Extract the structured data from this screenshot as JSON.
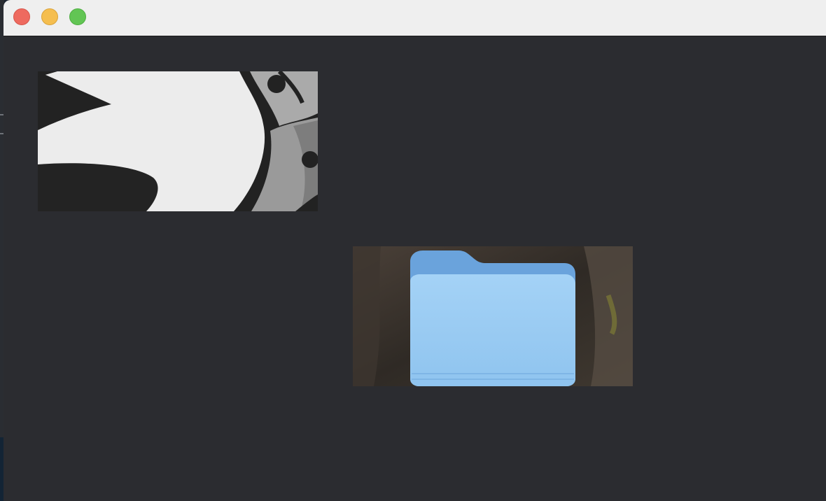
{
  "window": {
    "controls": [
      {
        "name": "close",
        "color": "#ee6a5f"
      },
      {
        "name": "minimize",
        "color": "#f5be4f"
      },
      {
        "name": "maximize",
        "color": "#62c554"
      }
    ],
    "background_color": "#2b2c30"
  },
  "images": [
    {
      "icon": "bird-gear-icon",
      "description_colors": [
        "#ececec",
        "#222222",
        "#a8a8a8"
      ]
    },
    {
      "icon": "folder-icon",
      "description_colors": [
        "#9ccbf2",
        "#6aa3dc",
        "#3a342e"
      ]
    }
  ]
}
